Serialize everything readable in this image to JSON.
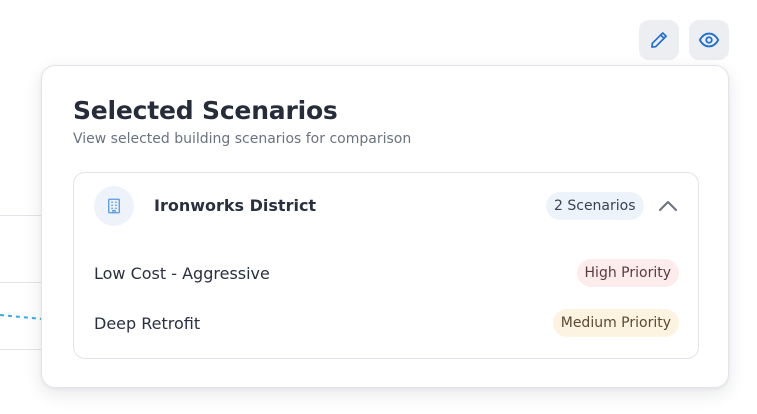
{
  "toolbar": {
    "edit_icon": "pencil-icon",
    "view_icon": "eye-icon"
  },
  "popover": {
    "title": "Selected Scenarios",
    "subtitle": "View selected building scenarios for comparison"
  },
  "group": {
    "icon": "building-icon",
    "name": "Ironworks District",
    "count_label": "2 Scenarios",
    "expanded": true,
    "scenarios": [
      {
        "name": "Low Cost - Aggressive",
        "priority": "High Priority"
      },
      {
        "name": "Deep Retrofit",
        "priority": "Medium Priority"
      }
    ]
  },
  "colors": {
    "accent": "#1f6fd1",
    "high_priority_bg": "#fdecec",
    "medium_priority_bg": "#fdf3e1",
    "chart_line": "#3aa9e6"
  }
}
